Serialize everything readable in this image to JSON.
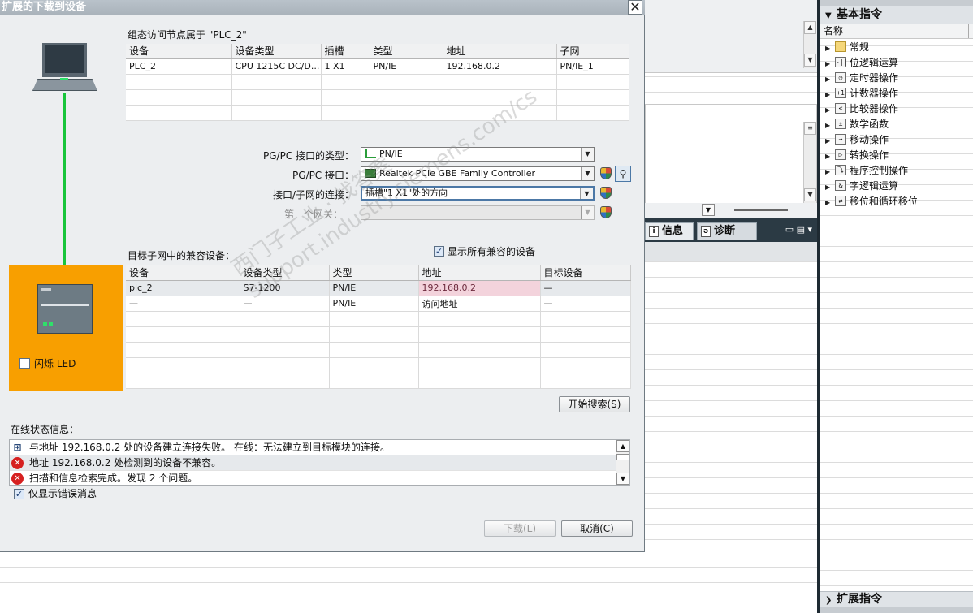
{
  "dialog": {
    "title": "扩展的下载到设备",
    "close": "✕",
    "config_caption": "组态访问节点属于 \"PLC_2\"",
    "config_table": {
      "headers": [
        "设备",
        "设备类型",
        "插槽",
        "类型",
        "地址",
        "子网"
      ],
      "rows": [
        [
          "PLC_2",
          "CPU 1215C DC/D...",
          "1 X1",
          "PN/IE",
          "192.168.0.2",
          "PN/IE_1"
        ]
      ]
    },
    "pgpc_type_label": "PG/PC 接口的类型：",
    "pgpc_type_value": "PN/IE",
    "pgpc_if_label": "PG/PC 接口：",
    "pgpc_if_value": "Realtek PCIe GBE Family Controller",
    "conn_label": "接口/子网的连接：",
    "conn_value": "插槽\"1 X1\"处的方向",
    "gateway_label": "第一个网关：",
    "gateway_value": "",
    "target_caption": "目标子网中的兼容设备：",
    "show_all_label": "显示所有兼容的设备",
    "target_table": {
      "headers": [
        "设备",
        "设备类型",
        "类型",
        "地址",
        "目标设备"
      ],
      "rows": [
        [
          "plc_2",
          "S7-1200",
          "PN/IE",
          "192.168.0.2",
          "—"
        ],
        [
          "—",
          "—",
          "PN/IE",
          "访问地址",
          "—"
        ]
      ]
    },
    "flash_led": "闪烁 LED",
    "search_btn": "开始搜索(S)",
    "status_caption": "在线状态信息：",
    "status": [
      {
        "icon": "network-icon",
        "text": "与地址 192.168.0.2 处的设备建立连接失败。 在线：无法建立到目标模块的连接。"
      },
      {
        "icon": "error-icon",
        "text": "地址 192.168.0.2 处检测到的设备不兼容。"
      },
      {
        "icon": "error-icon",
        "text": "扫描和信息检索完成。发现 2 个问题。"
      }
    ],
    "errors_only": "仅显示错误消息",
    "download_btn": "下载(L)",
    "cancel_btn": "取消(C)"
  },
  "portal": {
    "tab_info": "信息",
    "tab_diag": "诊断"
  },
  "right_pane": {
    "header": "基本指令",
    "col_name": "名称",
    "items": [
      {
        "label": "常规",
        "icon": "folder-icon",
        "glyph": ""
      },
      {
        "label": "位逻辑运算",
        "icon": "bitlogic-icon",
        "glyph": "-||"
      },
      {
        "label": "定时器操作",
        "icon": "timer-icon",
        "glyph": "◷"
      },
      {
        "label": "计数器操作",
        "icon": "counter-icon",
        "glyph": "+1"
      },
      {
        "label": "比较器操作",
        "icon": "compare-icon",
        "glyph": "<"
      },
      {
        "label": "数学函数",
        "icon": "math-icon",
        "glyph": "±"
      },
      {
        "label": "移动操作",
        "icon": "move-icon",
        "glyph": "→"
      },
      {
        "label": "转换操作",
        "icon": "convert-icon",
        "glyph": "▷"
      },
      {
        "label": "程序控制操作",
        "icon": "program-control-icon",
        "glyph": "⤵"
      },
      {
        "label": "字逻辑运算",
        "icon": "wordlogic-icon",
        "glyph": "&"
      },
      {
        "label": "移位和循环移位",
        "icon": "shift-icon",
        "glyph": "⇄"
      }
    ],
    "footer": "扩展指令"
  },
  "watermark": {
    "line1": "西门子工业 · 找答案",
    "line2": "support.industry.siemens.com/cs"
  }
}
